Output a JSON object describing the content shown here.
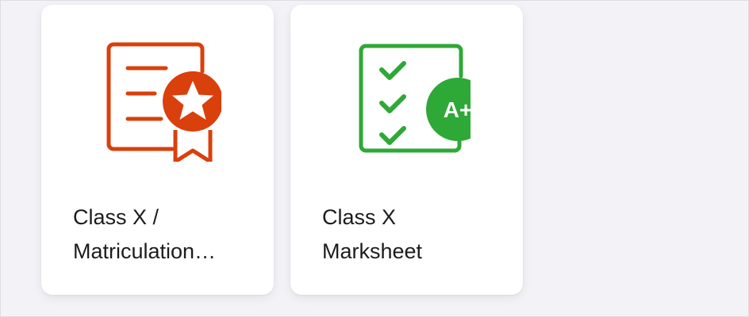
{
  "cards": [
    {
      "line1": "Class X /",
      "line2": "Matriculation…",
      "icon": "certificate-ribbon-icon",
      "color": "#d9400c"
    },
    {
      "line1": "Class X",
      "line2": "Marksheet",
      "icon": "marksheet-grade-icon",
      "color": "#2ea836",
      "badge": "A+"
    }
  ]
}
